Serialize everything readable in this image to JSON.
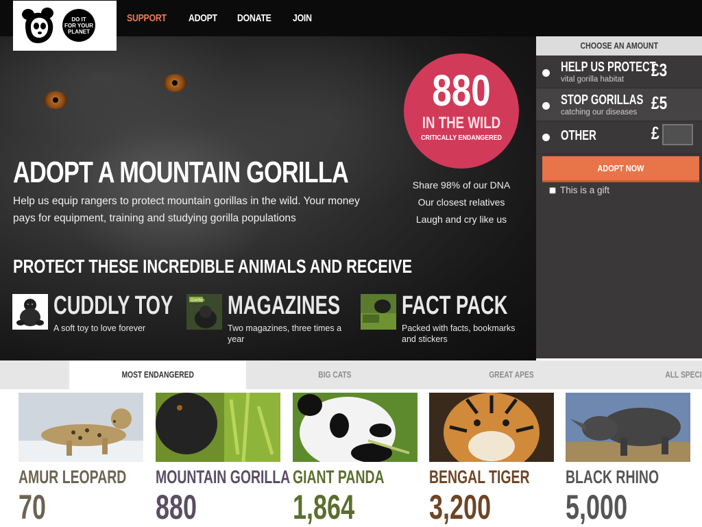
{
  "header": {
    "badge_text": "DO IT\nFOR YOUR\nPLANET",
    "nav": [
      {
        "label": "SUPPORT",
        "active": true
      },
      {
        "label": "ADOPT",
        "active": false
      },
      {
        "label": "DONATE",
        "active": false
      },
      {
        "label": "JOIN",
        "active": false
      }
    ]
  },
  "hero": {
    "title": "ADOPT A MOUNTAIN GORILLA",
    "description": "Help us equip rangers to protect mountain gorillas in the wild. Your money pays for equipment, training and studying gorilla populations",
    "subtitle": "PROTECT THESE INCREDIBLE ANIMALS AND RECEIVE",
    "stat": {
      "number": "880",
      "label": "IN THE WILD",
      "status": "CRITICALLY ENDANGERED"
    },
    "facts": [
      "Share 98% of our DNA",
      "Our closest relatives",
      "Laugh and cry like us"
    ],
    "rewards": [
      {
        "title": "CUDDLY TOY",
        "desc": "A soft toy to love forever"
      },
      {
        "title": "MAGAZINES",
        "desc": "Two magazines, three times a year"
      },
      {
        "title": "FACT PACK",
        "desc": "Packed with facts, bookmarks and stickers"
      }
    ]
  },
  "panel": {
    "heading": "CHOOSE AN AMOUNT",
    "options": [
      {
        "title": "HELP US PROTECT",
        "sub": "vital gorilla habitat",
        "price": "£3"
      },
      {
        "title": "STOP GORILLAS",
        "sub": "catching our diseases",
        "price": "£5"
      },
      {
        "title": "OTHER",
        "sub": "",
        "price": "£"
      }
    ],
    "other_value": "",
    "button": "ADOPT NOW",
    "gift_label": "This is a gift"
  },
  "tabs": [
    "MOST ENDANGERED",
    "BIG CATS",
    "GREAT APES",
    "ALL SPECIES"
  ],
  "animals": [
    {
      "name": "AMUR LEOPARD",
      "count": "70",
      "color": "#6b6452"
    },
    {
      "name": "MOUNTAIN GORILLA",
      "count": "880",
      "color": "#5a4e63"
    },
    {
      "name": "GIANT PANDA",
      "count": "1,864",
      "color": "#5b6e2f"
    },
    {
      "name": "BENGAL TIGER",
      "count": "3,200",
      "color": "#6e4526"
    },
    {
      "name": "BLACK RHINO",
      "count": "5,000",
      "color": "#555555"
    }
  ],
  "colors": {
    "accent": "#f07b52",
    "stat_circle": "#d23a5a",
    "button": "#e8744a"
  }
}
